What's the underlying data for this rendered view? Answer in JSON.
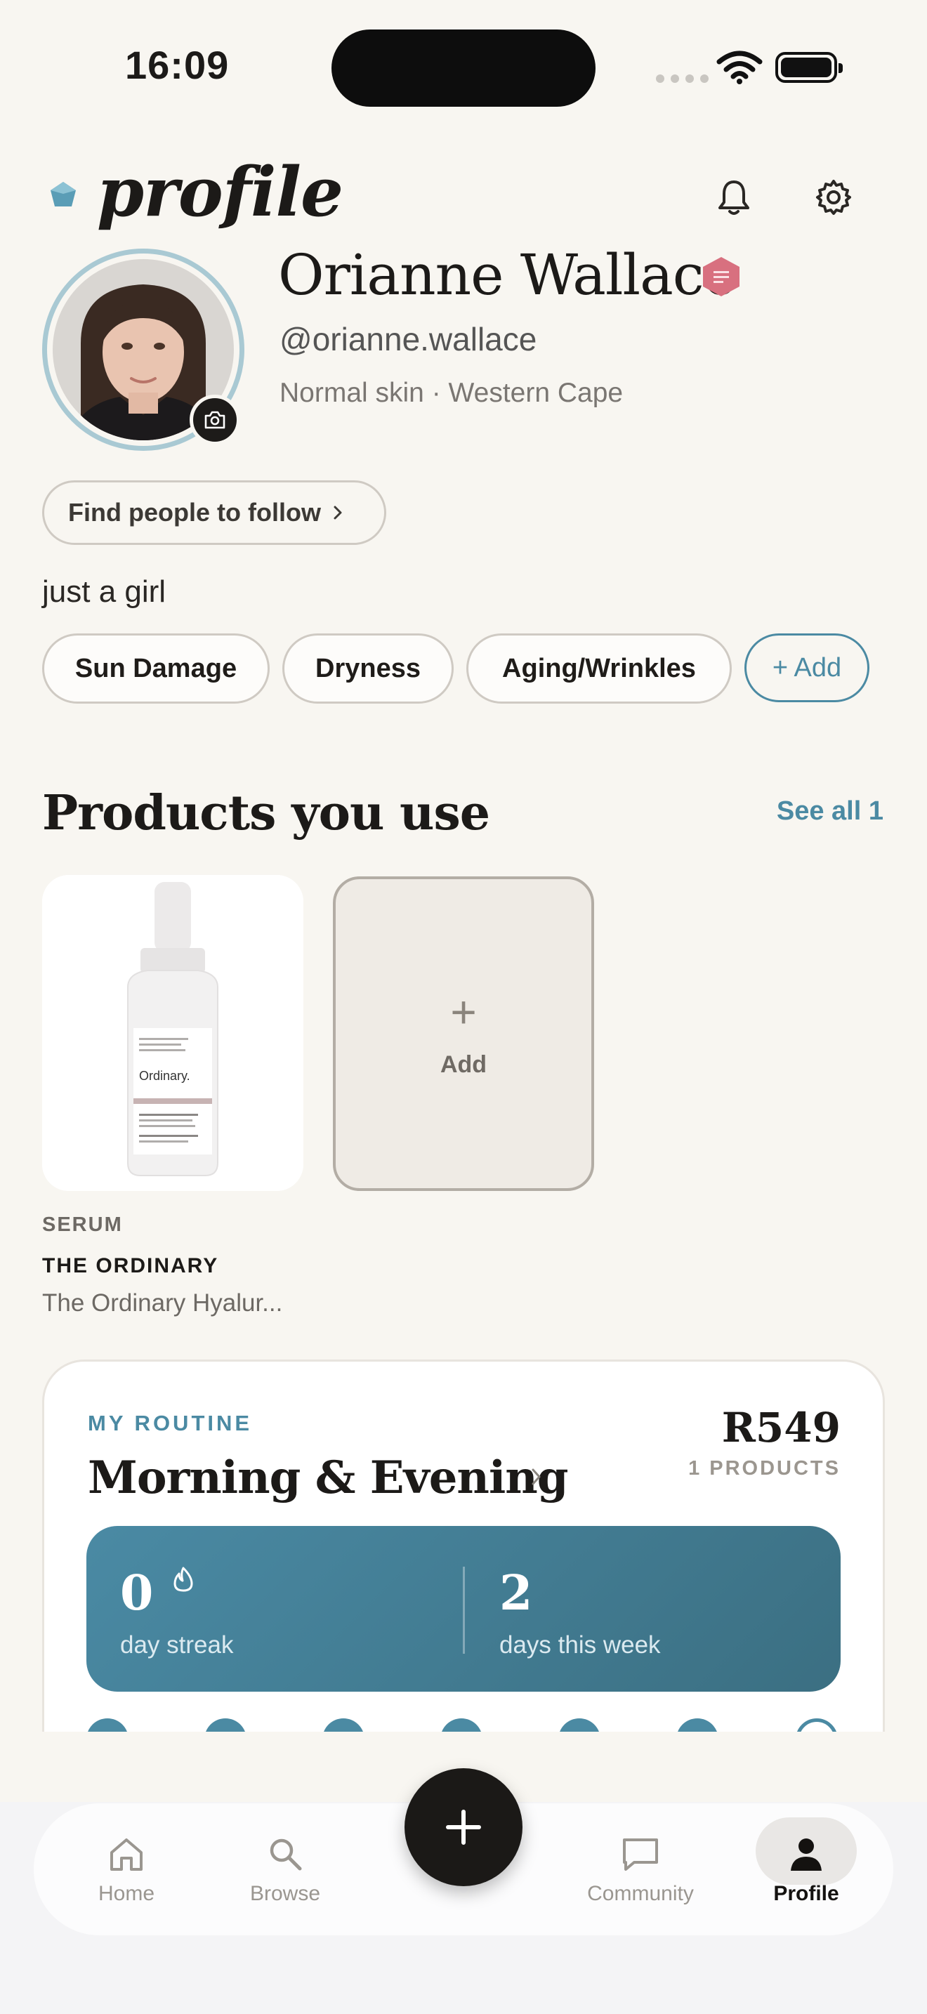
{
  "status_bar": {
    "time": "16:09"
  },
  "header": {
    "title": "profile"
  },
  "profile": {
    "name": "Orianne Wallace",
    "handle": "@orianne.wallace",
    "meta": "Normal skin · Western Cape",
    "follow_label": "Find people to follow",
    "bio": "just a girl",
    "concerns": [
      "Sun Damage",
      "Dryness",
      "Aging/Wrinkles"
    ],
    "add_concern_label": "+ Add"
  },
  "products": {
    "title": "Products you use",
    "see_all_label": "See all 1",
    "items": [
      {
        "category": "SERUM",
        "brand": "THE ORDINARY",
        "name": "The Ordinary Hyalur..."
      }
    ],
    "add_label": "Add"
  },
  "routine": {
    "kicker": "MY ROUTINE",
    "title": "Morning & Evening",
    "price": "R549",
    "count": "1 PRODUCTS",
    "streak_value": "0",
    "streak_label": "day streak",
    "week_value": "2",
    "week_label": "days this week"
  },
  "nav": {
    "items": [
      {
        "label": "Home",
        "icon": "home-icon"
      },
      {
        "label": "Browse",
        "icon": "search-icon"
      },
      {
        "label": "Community",
        "icon": "chat-icon"
      },
      {
        "label": "Profile",
        "icon": "person-icon",
        "active": true
      }
    ],
    "fab_icon": "plus-icon"
  },
  "colors": {
    "background": "#f8f6f1",
    "accent": "#4b8aa3",
    "dark": "#1b1917",
    "badge": "#d8707f"
  }
}
